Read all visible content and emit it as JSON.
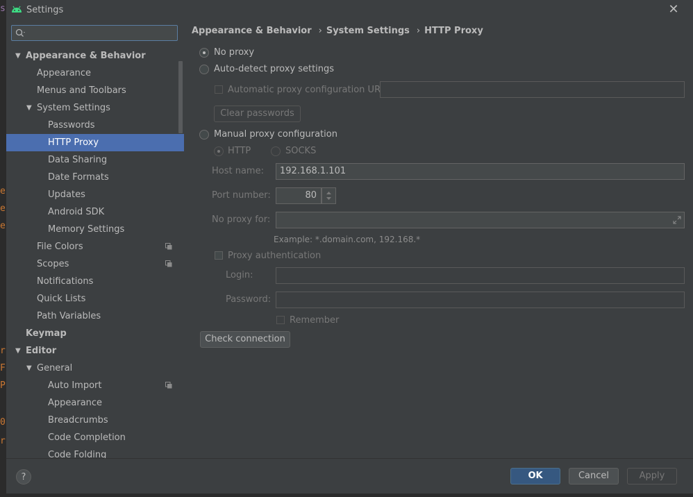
{
  "window": {
    "title": "Settings"
  },
  "search": {
    "placeholder": ""
  },
  "tree": [
    {
      "label": "Appearance & Behavior",
      "level": 0,
      "arrow": "down",
      "bold": true
    },
    {
      "label": "Appearance",
      "level": 1
    },
    {
      "label": "Menus and Toolbars",
      "level": 1
    },
    {
      "label": "System Settings",
      "level": 1,
      "arrow": "down"
    },
    {
      "label": "Passwords",
      "level": 2
    },
    {
      "label": "HTTP Proxy",
      "level": 2,
      "selected": true
    },
    {
      "label": "Data Sharing",
      "level": 2
    },
    {
      "label": "Date Formats",
      "level": 2
    },
    {
      "label": "Updates",
      "level": 2
    },
    {
      "label": "Android SDK",
      "level": 2
    },
    {
      "label": "Memory Settings",
      "level": 2
    },
    {
      "label": "File Colors",
      "level": 1,
      "copy": true
    },
    {
      "label": "Scopes",
      "level": 1,
      "copy": true
    },
    {
      "label": "Notifications",
      "level": 1
    },
    {
      "label": "Quick Lists",
      "level": 1
    },
    {
      "label": "Path Variables",
      "level": 1
    },
    {
      "label": "Keymap",
      "level": 0,
      "bold": true
    },
    {
      "label": "Editor",
      "level": 0,
      "arrow": "down",
      "bold": true
    },
    {
      "label": "General",
      "level": 1,
      "arrow": "down"
    },
    {
      "label": "Auto Import",
      "level": 2,
      "copy": true
    },
    {
      "label": "Appearance",
      "level": 2
    },
    {
      "label": "Breadcrumbs",
      "level": 2
    },
    {
      "label": "Code Completion",
      "level": 2
    },
    {
      "label": "Code Folding",
      "level": 2
    }
  ],
  "breadcrumb": [
    "Appearance & Behavior",
    "System Settings",
    "HTTP Proxy"
  ],
  "proxy": {
    "no_proxy": "No proxy",
    "auto_detect": "Auto-detect proxy settings",
    "auto_config_url": "Automatic proxy configuration URL:",
    "clear_passwords": "Clear passwords",
    "manual": "Manual proxy configuration",
    "http": "HTTP",
    "socks": "SOCKS",
    "host_label": "Host name:",
    "host_value": "192.168.1.101",
    "port_label": "Port number:",
    "port_value": "80",
    "noproxy_label": "No proxy for:",
    "example": "Example: *.domain.com, 192.168.*",
    "auth": "Proxy authentication",
    "login_label": "Login:",
    "password_label": "Password:",
    "remember": "Remember",
    "check_connection": "Check connection"
  },
  "footer": {
    "ok": "OK",
    "cancel": "Cancel",
    "apply": "Apply",
    "help": "?"
  },
  "colors": {
    "accent": "#4b6eaf",
    "background": "#3c3f41",
    "ok_button": "#365880"
  }
}
